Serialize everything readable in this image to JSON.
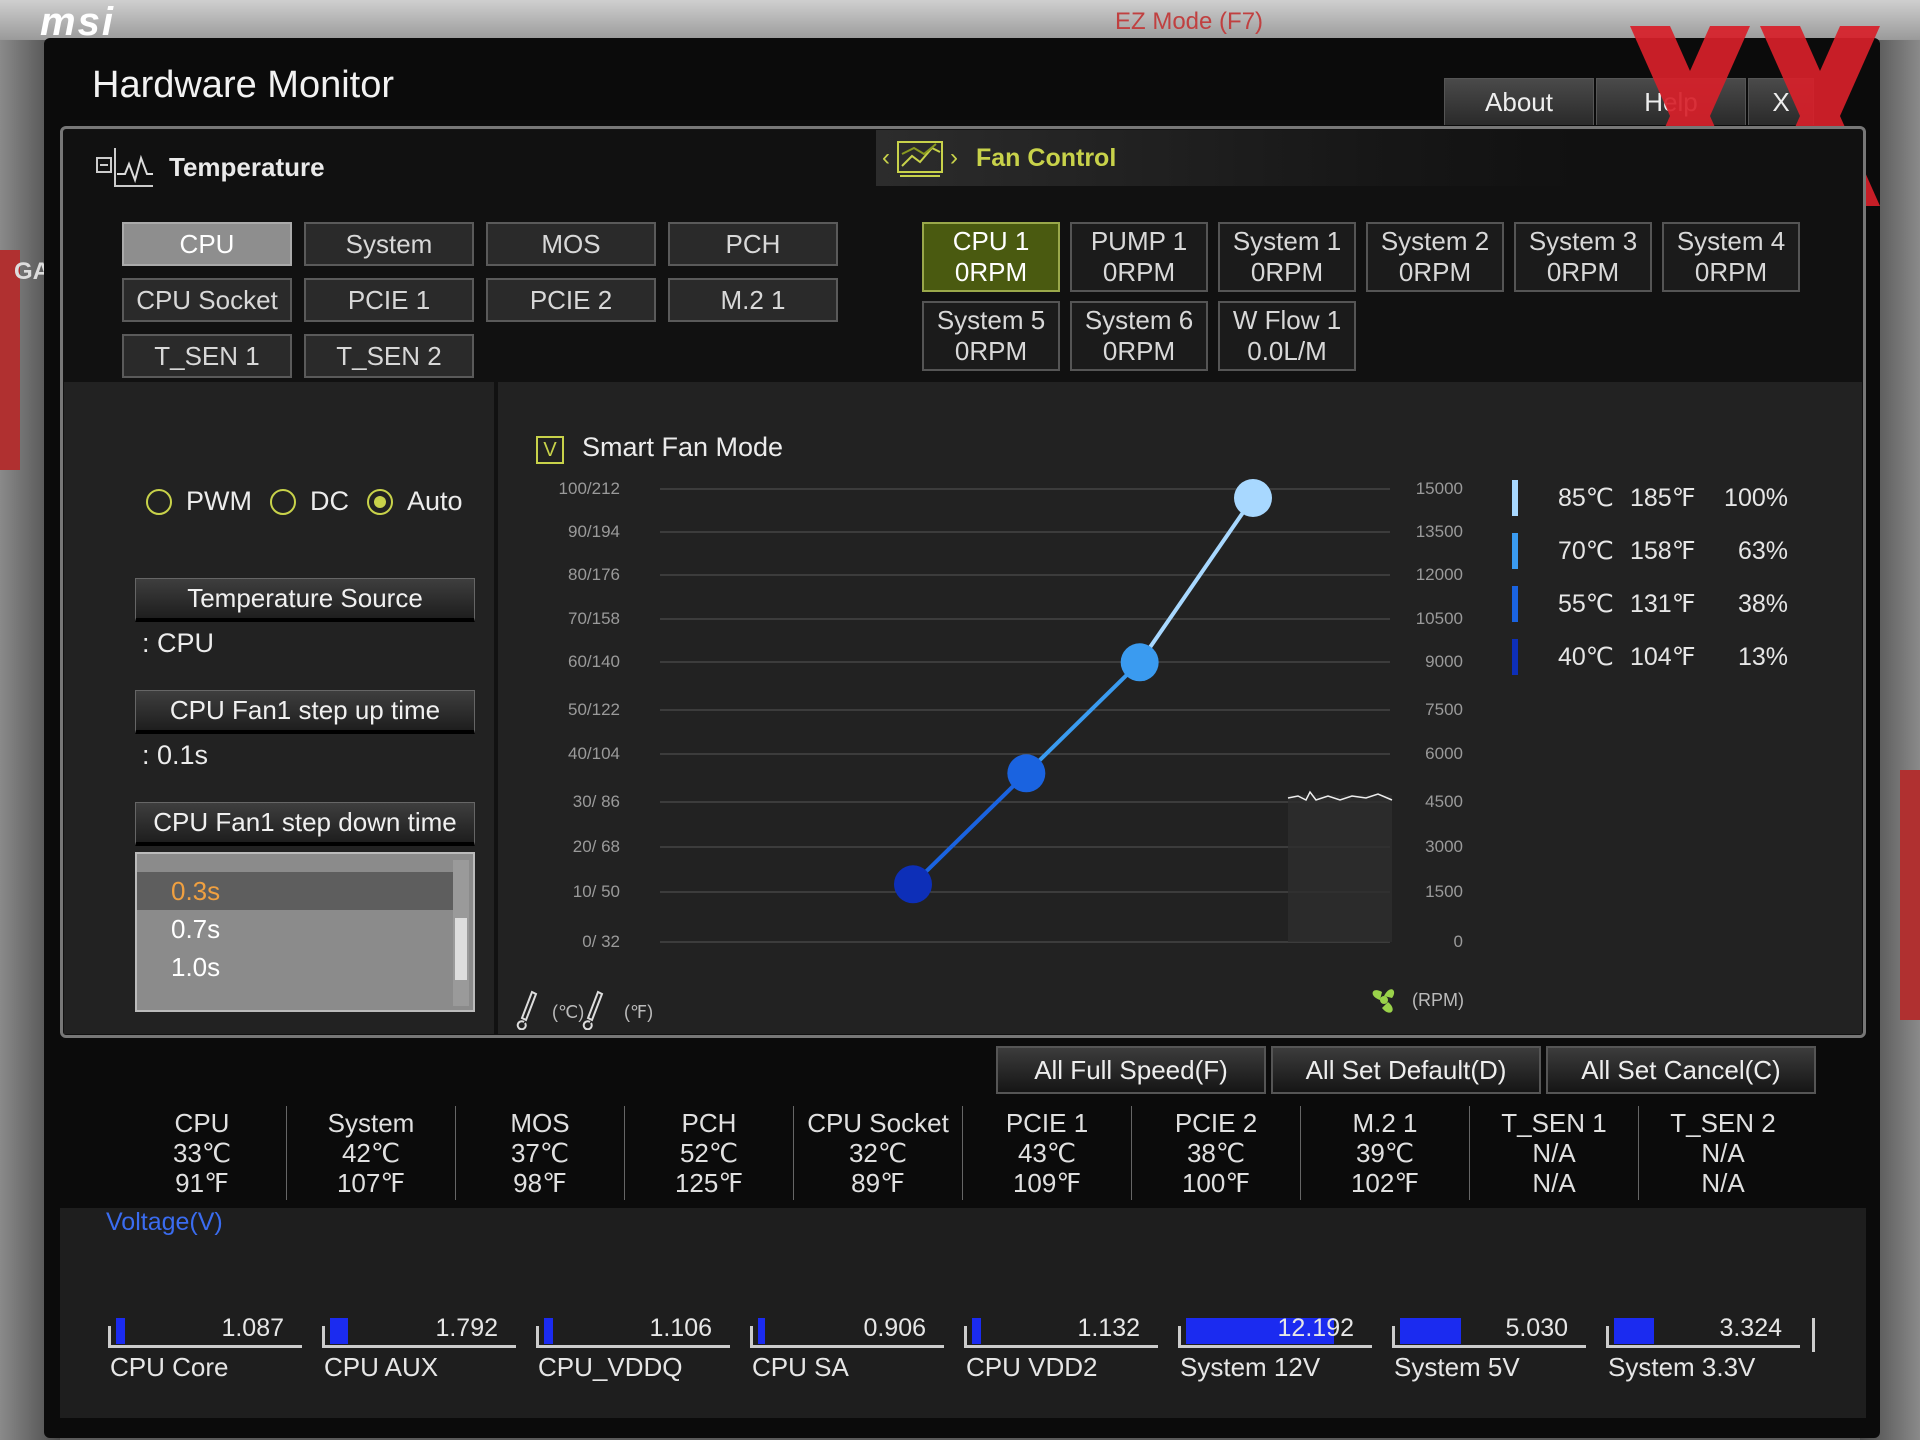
{
  "background": {
    "logo": "msi",
    "ez_mode": "EZ Mode (F7)",
    "side_label": "GA"
  },
  "window": {
    "title": "Hardware Monitor",
    "about_label": "About",
    "help_label": "Help",
    "close_label": "X"
  },
  "temperature_tab": {
    "label": "Temperature"
  },
  "fan_control_tab": {
    "label": "Fan Control"
  },
  "temperature_sensors": [
    {
      "label": "CPU",
      "selected": true
    },
    {
      "label": "System"
    },
    {
      "label": "MOS"
    },
    {
      "label": "PCH"
    },
    {
      "label": "CPU Socket"
    },
    {
      "label": "PCIE 1"
    },
    {
      "label": "PCIE 2"
    },
    {
      "label": "M.2 1"
    },
    {
      "label": "T_SEN 1"
    },
    {
      "label": "T_SEN 2"
    }
  ],
  "fans": [
    {
      "name": "CPU 1",
      "value": "0RPM",
      "selected": true
    },
    {
      "name": "PUMP 1",
      "value": "0RPM"
    },
    {
      "name": "System 1",
      "value": "0RPM"
    },
    {
      "name": "System 2",
      "value": "0RPM"
    },
    {
      "name": "System 3",
      "value": "0RPM"
    },
    {
      "name": "System 4",
      "value": "0RPM"
    },
    {
      "name": "System 5",
      "value": "0RPM"
    },
    {
      "name": "System 6",
      "value": "0RPM"
    },
    {
      "name": "W Flow 1",
      "value": "0.0L/M"
    }
  ],
  "fan_mode": {
    "options": [
      "PWM",
      "DC",
      "Auto"
    ],
    "selected": "Auto"
  },
  "temperature_source": {
    "label": "Temperature Source",
    "value": ": CPU"
  },
  "step_up": {
    "label": "CPU Fan1 step up time",
    "value": ": 0.1s"
  },
  "step_down": {
    "label": "CPU Fan1 step down time",
    "options": [
      "0.3s",
      "0.7s",
      "1.0s"
    ],
    "selected": "0.3s"
  },
  "smart_fan": {
    "label": "Smart Fan Mode",
    "checked": true,
    "check_glyph": "V"
  },
  "chart_data": {
    "type": "line",
    "left_ticks": [
      "100/212",
      "90/194",
      "80/176",
      "70/158",
      "60/140",
      "50/122",
      "40/104",
      "30/ 86",
      "20/ 68",
      "10/ 50",
      "0/ 32"
    ],
    "right_ticks": [
      "15000",
      "13500",
      "12000",
      "10500",
      "9000",
      "7500",
      "6000",
      "4500",
      "3000",
      "1500",
      "0"
    ],
    "xlabel_c": "(℃)",
    "xlabel_f": "(℉)",
    "ylabel_right": "(RPM)",
    "curve_points": [
      {
        "temp_c": 40,
        "percent": 13,
        "color": "#0d2fb8"
      },
      {
        "temp_c": 55,
        "percent": 38,
        "color": "#1a63e0"
      },
      {
        "temp_c": 70,
        "percent": 63,
        "color": "#3a9bf0"
      },
      {
        "temp_c": 85,
        "percent": 100,
        "color": "#a8d8ff"
      }
    ]
  },
  "legend": [
    {
      "c": "85℃",
      "f": "185℉",
      "pct": "100%",
      "color": "#a8d8ff"
    },
    {
      "c": "70℃",
      "f": "158℉",
      "pct": "63%",
      "color": "#3a9bf0"
    },
    {
      "c": "55℃",
      "f": "131℉",
      "pct": "38%",
      "color": "#1a63e0"
    },
    {
      "c": "40℃",
      "f": "104℉",
      "pct": "13%",
      "color": "#0d2fb8"
    }
  ],
  "actions": {
    "full_speed": "All Full Speed(F)",
    "set_default": "All Set Default(D)",
    "set_cancel": "All Set Cancel(C)"
  },
  "temps": [
    {
      "name": "CPU",
      "c": "33℃",
      "f": "91℉"
    },
    {
      "name": "System",
      "c": "42℃",
      "f": "107℉"
    },
    {
      "name": "MOS",
      "c": "37℃",
      "f": "98℉"
    },
    {
      "name": "PCH",
      "c": "52℃",
      "f": "125℉"
    },
    {
      "name": "CPU Socket",
      "c": "32℃",
      "f": "89℉"
    },
    {
      "name": "PCIE 1",
      "c": "43℃",
      "f": "109℉"
    },
    {
      "name": "PCIE 2",
      "c": "38℃",
      "f": "100℉"
    },
    {
      "name": "M.2 1",
      "c": "39℃",
      "f": "102℉"
    },
    {
      "name": "T_SEN 1",
      "c": "N/A",
      "f": "N/A"
    },
    {
      "name": "T_SEN 2",
      "c": "N/A",
      "f": "N/A"
    }
  ],
  "voltage": {
    "title": "Voltage(V)",
    "items": [
      {
        "name": "CPU Core",
        "value": "1.087",
        "fill": 0.05
      },
      {
        "name": "CPU AUX",
        "value": "1.792",
        "fill": 0.1
      },
      {
        "name": "CPU_VDDQ",
        "value": "1.106",
        "fill": 0.05
      },
      {
        "name": "CPU SA",
        "value": "0.906",
        "fill": 0.04
      },
      {
        "name": "CPU VDD2",
        "value": "1.132",
        "fill": 0.05
      },
      {
        "name": "System 12V",
        "value": "12.192",
        "fill": 0.82
      },
      {
        "name": "System 5V",
        "value": "5.030",
        "fill": 0.34
      },
      {
        "name": "System 3.3V",
        "value": "3.324",
        "fill": 0.22
      }
    ]
  }
}
